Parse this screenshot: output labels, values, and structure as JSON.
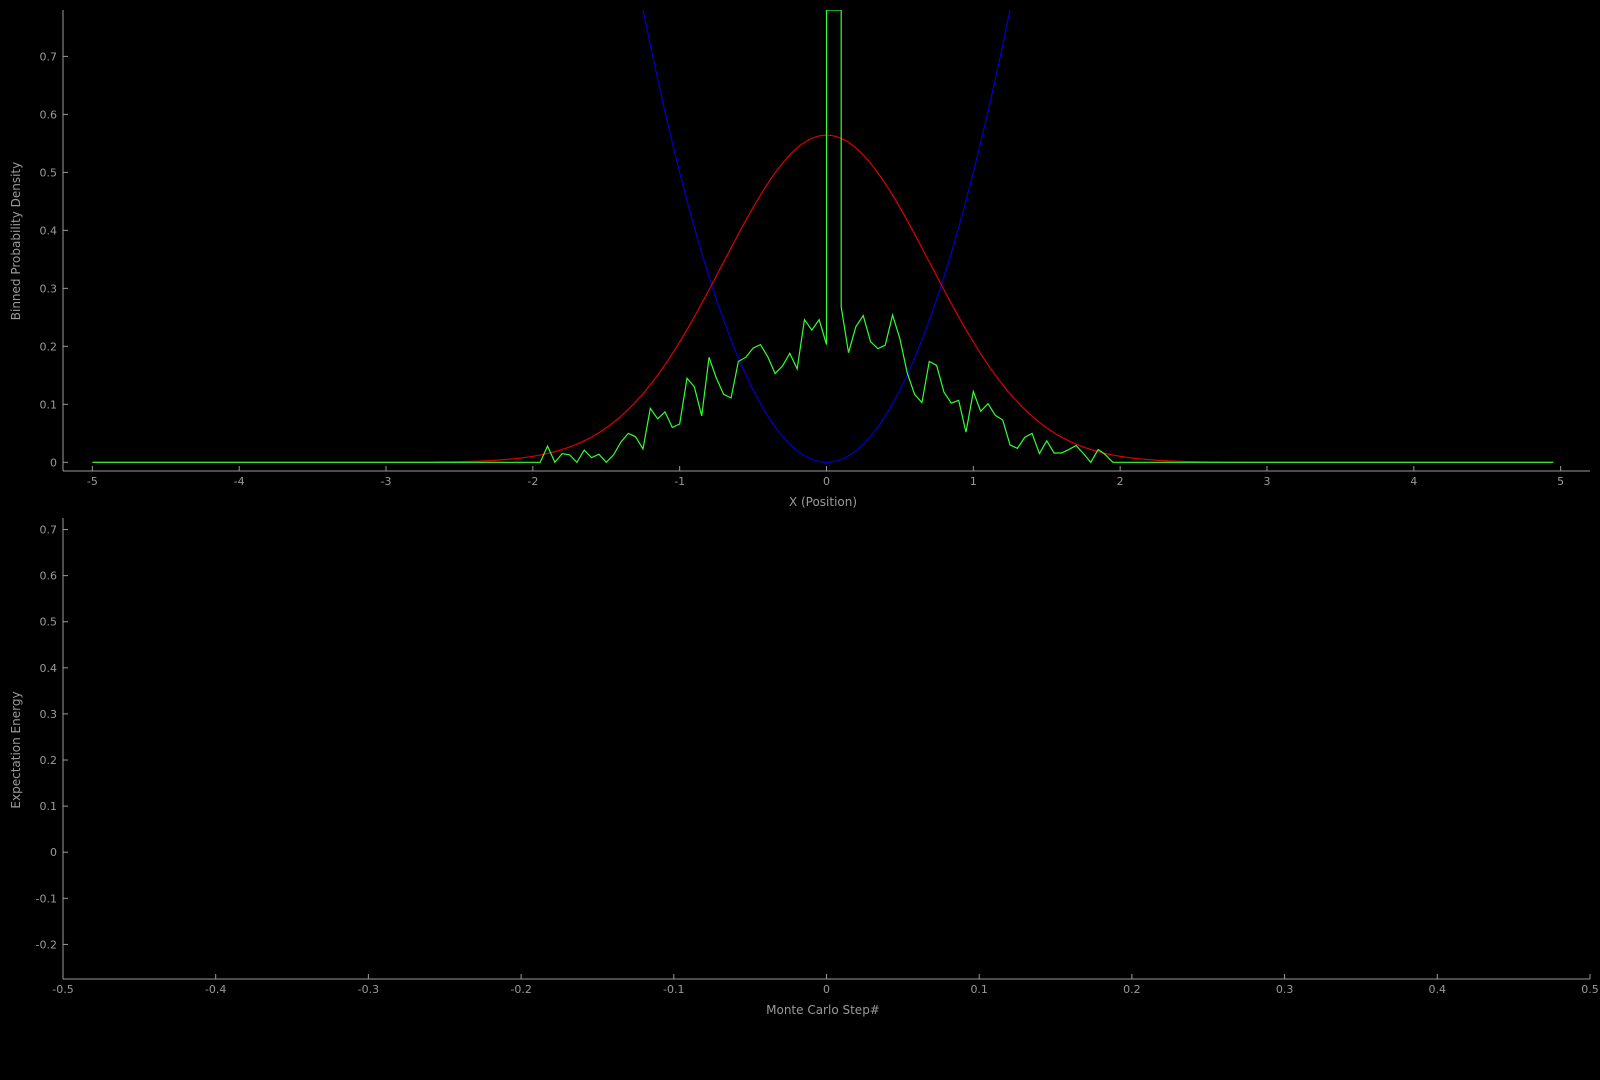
{
  "chart_data": [
    {
      "type": "line",
      "title": "",
      "xlabel": "X (Position)",
      "ylabel": "Binned Probability Density",
      "xlim": [
        -5.2,
        5.2
      ],
      "ylim": [
        -0.015,
        0.78
      ],
      "grid": false,
      "x_ticks": [
        -5,
        -4,
        -3,
        -2,
        -1,
        0,
        1,
        2,
        3,
        4,
        5
      ],
      "x_tick_labels": [
        "-5",
        "-4",
        "-3",
        "-2",
        "-1",
        "0",
        "1",
        "2",
        "3",
        "4",
        "5"
      ],
      "y_ticks": [
        0,
        0.1,
        0.2,
        0.3,
        0.4,
        0.5,
        0.6,
        0.7
      ],
      "y_tick_labels": [
        "0",
        "0.1",
        "0.2",
        "0.3",
        "0.4",
        "0.5",
        "0.6",
        "0.7"
      ],
      "series": [
        {
          "color": "#0000cc",
          "kind": "function",
          "formula": "0.5*x^2",
          "x_range": [
            -1.25,
            1.25
          ]
        },
        {
          "color": "#dd0000",
          "kind": "function",
          "formula": "exp(-x^2)/sqrt(pi)",
          "x_range": [
            -5.0,
            4.95
          ]
        },
        {
          "color": "#33ff33",
          "kind": "points",
          "points": [
            [
              -5.0,
              0
            ],
            [
              -1.95,
              0
            ],
            [
              -1.9,
              0.028
            ],
            [
              -1.85,
              0
            ],
            [
              -1.8,
              0.015
            ],
            [
              -1.75,
              0.013
            ],
            [
              -1.7,
              0
            ],
            [
              -1.65,
              0.021
            ],
            [
              -1.6,
              0.008
            ],
            [
              -1.55,
              0.014
            ],
            [
              -1.5,
              0
            ],
            [
              -1.45,
              0.013
            ],
            [
              -1.4,
              0.035
            ],
            [
              -1.35,
              0.05
            ],
            [
              -1.3,
              0.044
            ],
            [
              -1.25,
              0.023
            ],
            [
              -1.2,
              0.093
            ],
            [
              -1.15,
              0.075
            ],
            [
              -1.1,
              0.087
            ],
            [
              -1.05,
              0.06
            ],
            [
              -1.0,
              0.066
            ],
            [
              -0.95,
              0.145
            ],
            [
              -0.9,
              0.13
            ],
            [
              -0.85,
              0.08
            ],
            [
              -0.8,
              0.181
            ],
            [
              -0.75,
              0.145
            ],
            [
              -0.7,
              0.117
            ],
            [
              -0.65,
              0.111
            ],
            [
              -0.6,
              0.174
            ],
            [
              -0.55,
              0.181
            ],
            [
              -0.5,
              0.197
            ],
            [
              -0.45,
              0.203
            ],
            [
              -0.4,
              0.182
            ],
            [
              -0.35,
              0.153
            ],
            [
              -0.3,
              0.166
            ],
            [
              -0.25,
              0.188
            ],
            [
              -0.2,
              0.161
            ],
            [
              -0.15,
              0.246
            ],
            [
              -0.1,
              0.228
            ],
            [
              -0.05,
              0.246
            ],
            [
              0.0,
              0.203
            ],
            [
              0.0,
              0.78
            ],
            [
              0.1,
              0.78
            ],
            [
              0.1,
              0.268
            ],
            [
              0.15,
              0.189
            ],
            [
              0.2,
              0.234
            ],
            [
              0.25,
              0.253
            ],
            [
              0.3,
              0.208
            ],
            [
              0.35,
              0.196
            ],
            [
              0.4,
              0.202
            ],
            [
              0.45,
              0.254
            ],
            [
              0.5,
              0.213
            ],
            [
              0.55,
              0.154
            ],
            [
              0.6,
              0.117
            ],
            [
              0.65,
              0.103
            ],
            [
              0.7,
              0.174
            ],
            [
              0.75,
              0.167
            ],
            [
              0.8,
              0.121
            ],
            [
              0.85,
              0.102
            ],
            [
              0.9,
              0.107
            ],
            [
              0.95,
              0.052
            ],
            [
              1.0,
              0.122
            ],
            [
              1.05,
              0.088
            ],
            [
              1.1,
              0.101
            ],
            [
              1.15,
              0.081
            ],
            [
              1.2,
              0.073
            ],
            [
              1.25,
              0.03
            ],
            [
              1.3,
              0.024
            ],
            [
              1.35,
              0.043
            ],
            [
              1.4,
              0.05
            ],
            [
              1.45,
              0.015
            ],
            [
              1.5,
              0.037
            ],
            [
              1.55,
              0.016
            ],
            [
              1.6,
              0.016
            ],
            [
              1.65,
              0.022
            ],
            [
              1.7,
              0.029
            ],
            [
              1.75,
              0.015
            ],
            [
              1.8,
              0.0
            ],
            [
              1.85,
              0.022
            ],
            [
              1.9,
              0.013
            ],
            [
              1.95,
              0.0
            ],
            [
              4.95,
              0
            ]
          ]
        }
      ]
    },
    {
      "type": "line",
      "title": "",
      "xlabel": "Monte Carlo Step#",
      "ylabel": "Expectation Energy",
      "xlim": [
        -0.5,
        0.5
      ],
      "ylim": [
        -0.275,
        0.725
      ],
      "grid": false,
      "x_ticks": [
        -0.5,
        -0.4,
        -0.3,
        -0.2,
        -0.1,
        0,
        0.1,
        0.2,
        0.3,
        0.4,
        0.5
      ],
      "x_tick_labels": [
        "-0.5",
        "-0.4",
        "-0.3",
        "-0.2",
        "-0.1",
        "0",
        "0.1",
        "0.2",
        "0.3",
        "0.4",
        "0.5"
      ],
      "y_ticks": [
        -0.2,
        -0.1,
        0,
        0.1,
        0.2,
        0.3,
        0.4,
        0.5,
        0.6,
        0.7
      ],
      "y_tick_labels": [
        "-0.2",
        "-0.1",
        "0",
        "0.1",
        "0.2",
        "0.3",
        "0.4",
        "0.5",
        "0.6",
        "0.7"
      ],
      "series": []
    }
  ]
}
